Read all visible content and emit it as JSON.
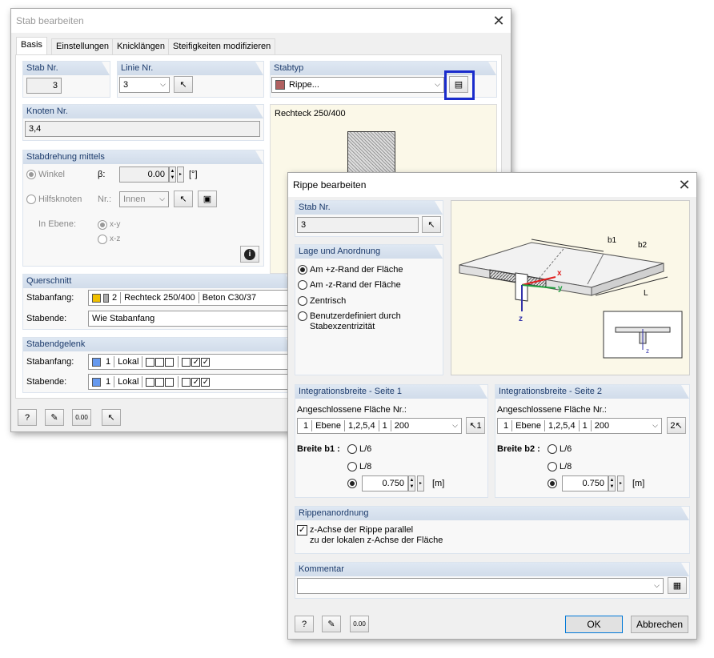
{
  "w1": {
    "title": "Stab bearbeiten",
    "tabs": [
      "Basis",
      "Einstellungen",
      "Knicklängen",
      "Steifigkeiten modifizieren"
    ],
    "stab_nr_label": "Stab Nr.",
    "stab_nr_value": "3",
    "linie_label": "Linie Nr.",
    "linie_value": "3",
    "stabtyp_label": "Stabtyp",
    "stabtyp_value": "Rippe...",
    "knoten_label": "Knoten Nr.",
    "knoten_value": "3,4",
    "preview_title": "Rechteck 250/400",
    "rot_label": "Stabdrehung mittels",
    "winkel_label": "Winkel",
    "beta_label": "β:",
    "beta_value": "0.00",
    "beta_unit": "[°]",
    "hilfs_label": "Hilfsknoten",
    "nr_label": "Nr.:",
    "nr_value": "Innen",
    "ebene_label": "In Ebene:",
    "xy": "x-y",
    "xz": "x-z",
    "qs_label": "Querschnitt",
    "anfang_label": "Stabanfang:",
    "ende_label": "Stabende:",
    "qs_nr": "2",
    "qs_name": "Rechteck 250/400",
    "qs_mat": "Beton C30/37",
    "qs_ende": "Wie Stabanfang",
    "gel_label": "Stabendgelenk",
    "gel_nr": "1",
    "gel_sys": "Lokal"
  },
  "w2": {
    "title": "Rippe bearbeiten",
    "stab_nr_label": "Stab Nr.",
    "stab_nr_value": "3",
    "lage_label": "Lage und Anordnung",
    "lage_opts": [
      "Am +z-Rand der Fläche",
      "Am -z-Rand der Fläche",
      "Zentrisch",
      "Benutzerdefiniert durch",
      "Stabexzentrizität"
    ],
    "ib1_label": "Integrationsbreite - Seite 1",
    "ib2_label": "Integrationsbreite - Seite 2",
    "flaeche_label": "Angeschlossene Fläche Nr.:",
    "fl_nr": "1",
    "fl_type": "Ebene",
    "fl_nodes": "1,2,5,4",
    "fl_mat": "1",
    "fl_d": "200",
    "breite_b1": "Breite b1 :",
    "breite_b2": "Breite b2 :",
    "l6": "L/6",
    "l8": "L/8",
    "b_value": "0.750",
    "unit_m": "[m]",
    "rip_label": "Rippenanordnung",
    "rip_check1": "z-Achse der Rippe parallel",
    "rip_check2": "zu der lokalen z-Achse der Fläche",
    "komm_label": "Kommentar",
    "ok": "OK",
    "cancel": "Abbrechen",
    "fig": {
      "b1": "b1",
      "b2": "b2",
      "L": "L",
      "x": "x",
      "y": "y",
      "z": "z"
    }
  }
}
